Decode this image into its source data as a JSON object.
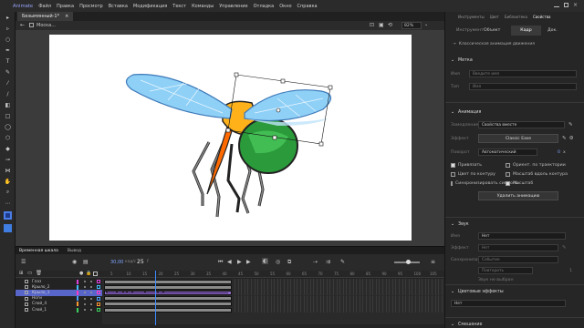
{
  "app": {
    "name": "Animate",
    "menu": [
      "Файл",
      "Правка",
      "Просмотр",
      "Вставка",
      "Модификация",
      "Текст",
      "Команды",
      "Управление",
      "Отладка",
      "Окно",
      "Справка"
    ],
    "doc_tab": "Безымянный-1*",
    "close_glyph": "×"
  },
  "scene": {
    "name": "Моска...",
    "zoom": "82%"
  },
  "timeline": {
    "tabs": [
      "Временная шкала",
      "Вывод"
    ],
    "fps": "30,00",
    "fps_unit": "кад/с",
    "frame": "25",
    "frame_unit": "F",
    "ruler": [
      "5",
      "10",
      "15",
      "20",
      "25",
      "30",
      "35",
      "40",
      "45",
      "50",
      "55",
      "60",
      "65",
      "70",
      "75",
      "80",
      "85",
      "90",
      "95",
      "100",
      "105"
    ],
    "layers": [
      {
        "name": "Глаз",
        "color": "#e040e0",
        "selected": false
      },
      {
        "name": "Крыло_2",
        "color": "#40c0ff",
        "selected": false
      },
      {
        "name": "Крыло_1",
        "color": "#ff3ac8",
        "selected": true
      },
      {
        "name": "Ноги",
        "color": "#4aa0ff",
        "selected": false
      },
      {
        "name": "Слой_4",
        "color": "#ff9933",
        "selected": false
      },
      {
        "name": "Слой_1",
        "color": "#3cd15e",
        "selected": false
      }
    ]
  },
  "props": {
    "top_tabs": [
      "Инструменты",
      "Цвет",
      "Библиотека",
      "Свойства"
    ],
    "sub_tabs": [
      "Инструмент",
      "Объект",
      "Кадр",
      "Док."
    ],
    "classic_tween_label": "Классическая анимация движения",
    "section_label": {
      "title": "Метка",
      "name_label": "Имя",
      "name_placeholder": "Введите имя",
      "type_label": "Тип",
      "type_value": "Имя"
    },
    "section_tween": {
      "title": "Анимация",
      "easing_label": "Замедление",
      "easing_value": "Свойства вместе",
      "effect_label": "Эффект",
      "effect_value": "Classic Ease",
      "rotate_label": "Поворот",
      "rotate_value": "Автоматический",
      "rotate_count": "0",
      "rotate_unit": "x",
      "checks": [
        {
          "label": "Привязать",
          "checked": true
        },
        {
          "label": "Ориент. по траектории",
          "checked": false
        },
        {
          "label": "Цвет по контуру",
          "checked": false
        },
        {
          "label": "Масштаб вдоль контура",
          "checked": false
        },
        {
          "label": "Синхронизировать символы",
          "checked": false
        },
        {
          "label": "Масштаб",
          "checked": true
        }
      ],
      "remove_button": "Удалить анимацию"
    },
    "section_sound": {
      "title": "Звук",
      "name_label": "Имя",
      "name_value": "Нет",
      "effect_label": "Эффект",
      "effect_value": "Нет",
      "sync_label": "Синхронизация",
      "sync_value": "Событие",
      "repeat_value": "Повторить",
      "repeat_count": "1",
      "no_sound": "Звук не выбран"
    },
    "section_color": {
      "title": "Цветовые эффекты",
      "value": "Нет"
    },
    "section_blend": {
      "title": "Смешение"
    }
  },
  "colors": {
    "accent": "#4b6eaf",
    "selected_layer": "#5866c9",
    "playhead": "#3d8bff"
  }
}
